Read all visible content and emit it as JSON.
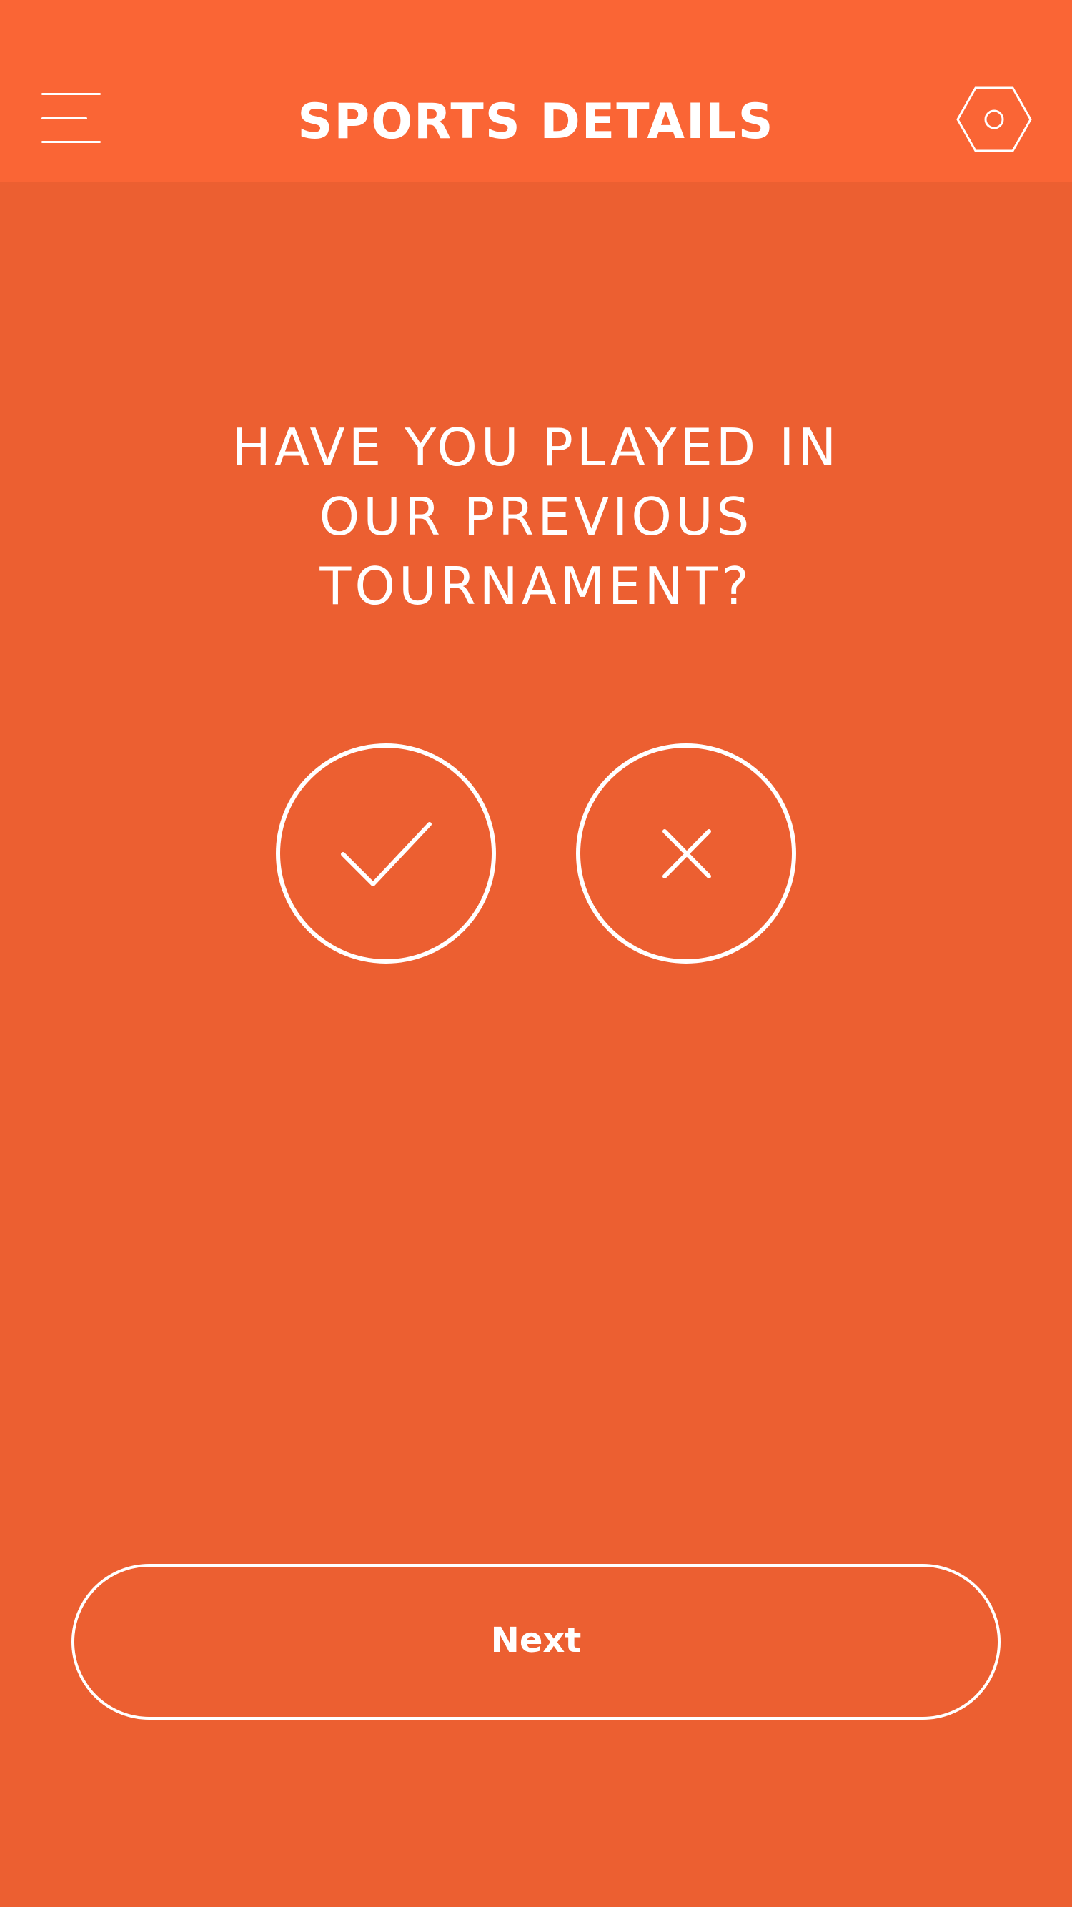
{
  "header": {
    "title": "SPORTS DETAILS",
    "menu_icon": "hamburger-menu-icon",
    "settings_icon": "hexagon-settings-icon"
  },
  "question": {
    "line1": "HAVE YOU PLAYED IN",
    "line2": "OUR PREVIOUS",
    "line3": "TOURNAMENT?"
  },
  "answers": [
    {
      "id": "yes",
      "icon": "checkmark-icon"
    },
    {
      "id": "no",
      "icon": "cross-icon"
    }
  ],
  "footer": {
    "next_label": "Next"
  },
  "colors": {
    "header_background": "#FA6535",
    "page_background": "#EC5F31",
    "foreground": "#FFFFFF"
  }
}
